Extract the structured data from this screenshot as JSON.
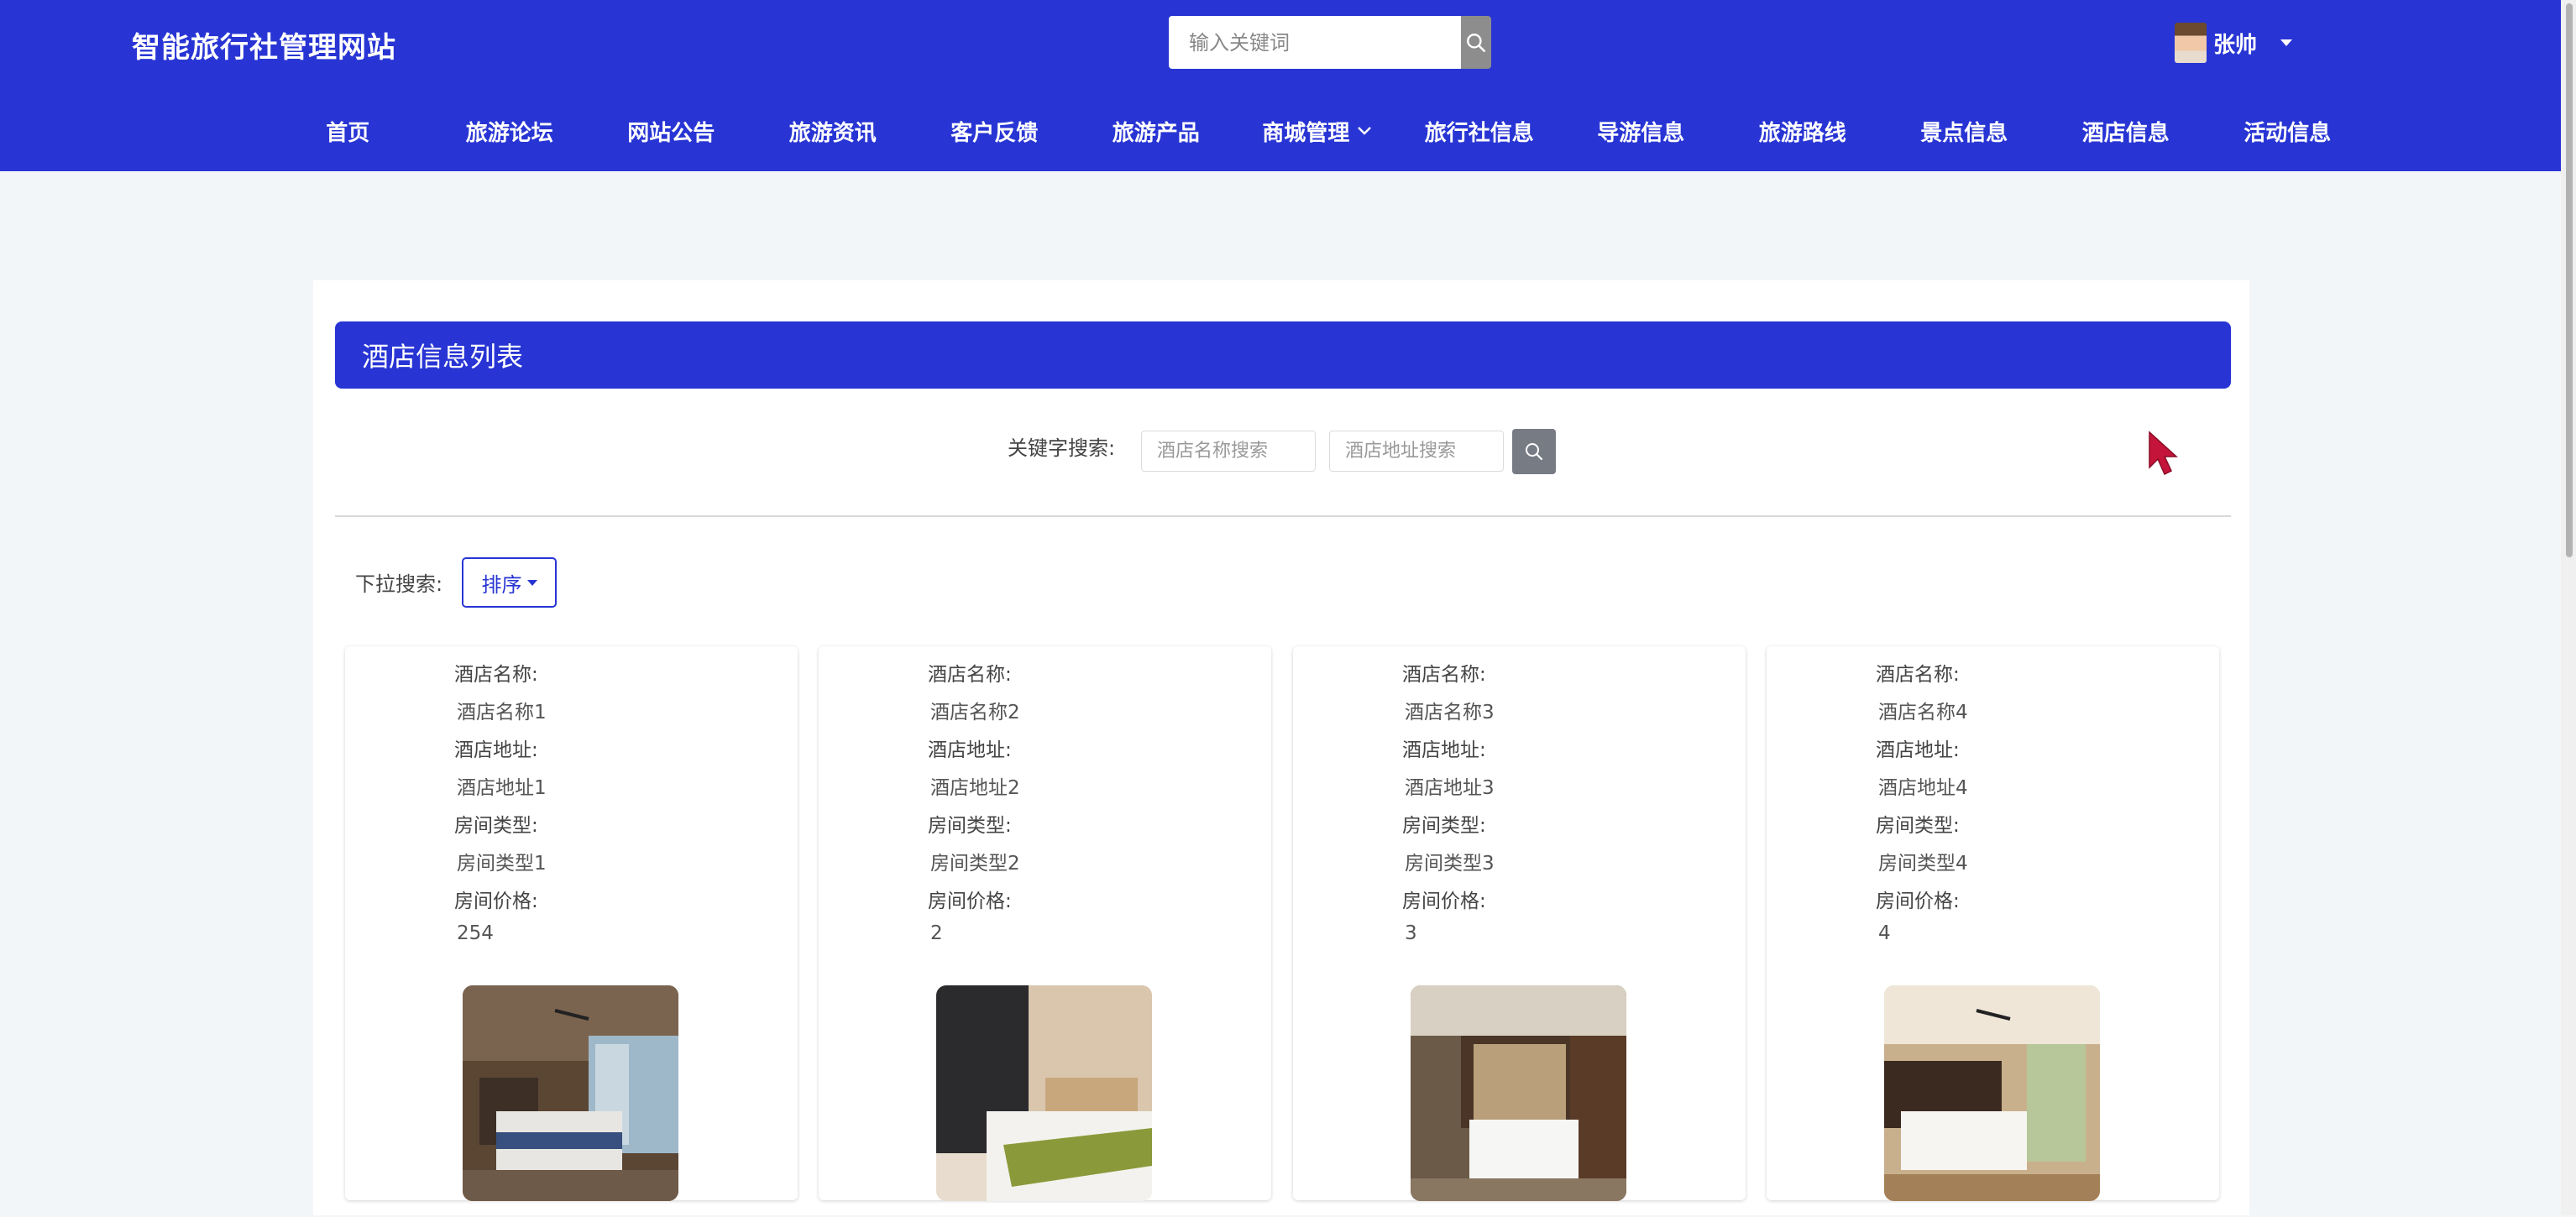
{
  "header": {
    "site_title": "智能旅行社管理网站",
    "search_placeholder": "输入关键词",
    "user_name": "张帅"
  },
  "nav": [
    {
      "label": "首页"
    },
    {
      "label": "旅游论坛"
    },
    {
      "label": "网站公告"
    },
    {
      "label": "旅游资讯"
    },
    {
      "label": "客户反馈"
    },
    {
      "label": "旅游产品"
    },
    {
      "label": "商城管理"
    },
    {
      "label": "旅行社信息"
    },
    {
      "label": "导游信息"
    },
    {
      "label": "旅游路线"
    },
    {
      "label": "景点信息"
    },
    {
      "label": "酒店信息"
    },
    {
      "label": "活动信息"
    }
  ],
  "list": {
    "title": "酒店信息列表",
    "keyword_label": "关键字搜索:",
    "name_placeholder": "酒店名称搜索",
    "address_placeholder": "酒店地址搜索",
    "dropdown_label": "下拉搜索:",
    "sort_label": "排序"
  },
  "labels": {
    "name": "酒店名称:",
    "address": "酒店地址:",
    "room_type": "房间类型:",
    "price": "房间价格:"
  },
  "hotels": [
    {
      "name": "酒店名称1",
      "address": "酒店地址1",
      "room_type": "房间类型1",
      "price": "254"
    },
    {
      "name": "酒店名称2",
      "address": "酒店地址2",
      "room_type": "房间类型2",
      "price": "2"
    },
    {
      "name": "酒店名称3",
      "address": "酒店地址3",
      "room_type": "房间类型3",
      "price": "3"
    },
    {
      "name": "酒店名称4",
      "address": "酒店地址4",
      "room_type": "房间类型4",
      "price": "4"
    }
  ],
  "colors": {
    "primary": "#2835d4",
    "search_button": "#8d8d8d",
    "cursor": "#c4143a"
  },
  "icons": {
    "search": "search-icon",
    "chevron": "chevron-down-icon",
    "cursor": "mouse-pointer-icon"
  }
}
